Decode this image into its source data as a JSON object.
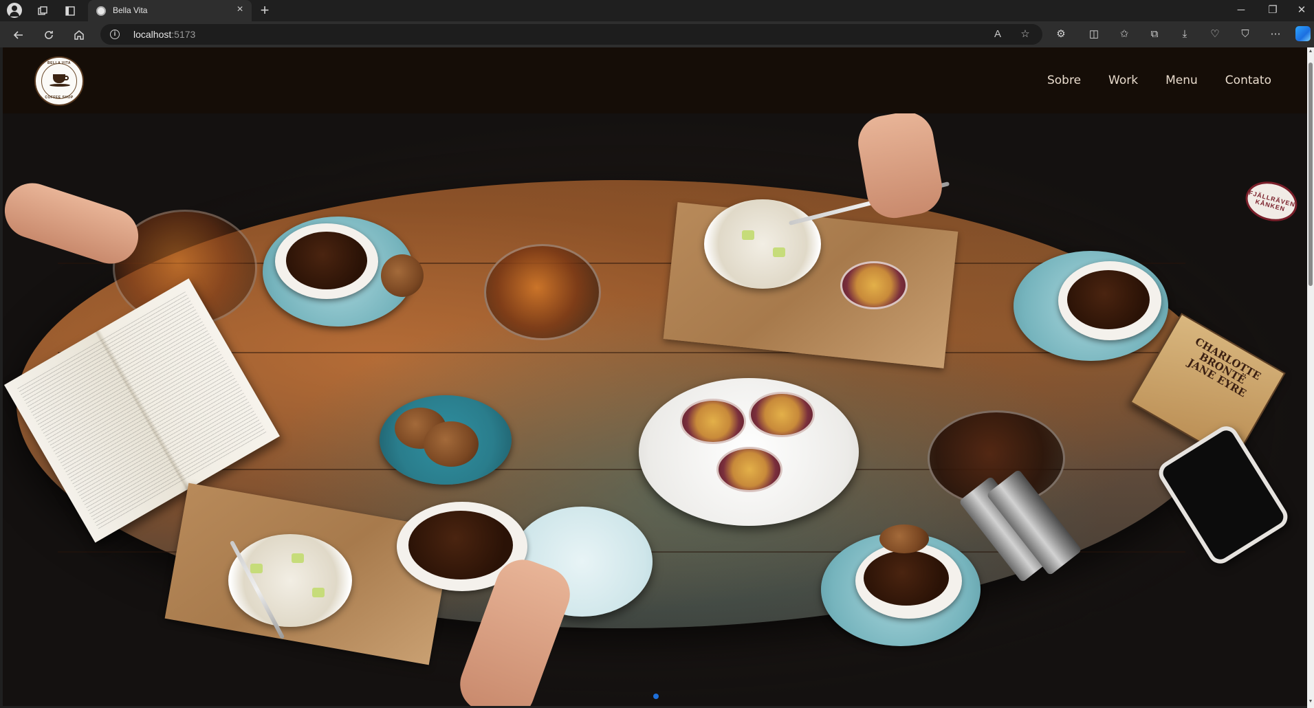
{
  "browser": {
    "tab_title": "Bella Vita",
    "tab_close": "×",
    "new_tab": "+",
    "url_host": "localhost",
    "url_port": ":5173",
    "window_controls": {
      "minimize": "─",
      "restore": "❐",
      "close": "✕"
    }
  },
  "site": {
    "logo": {
      "top_text": "BELLA VITA",
      "bottom_text": "COFFEE SHOP"
    },
    "nav": [
      {
        "label": "Sobre"
      },
      {
        "label": "Work"
      },
      {
        "label": "Menu"
      },
      {
        "label": "Contato"
      }
    ]
  },
  "hero": {
    "book_title": "CHARLOTTE BRONTË JANE EYRE",
    "sticker_text": "FJÄLLRÄVEN KÅNKEN",
    "carousel": {
      "active_index": 0,
      "accent_color": "#1e6fd9"
    }
  },
  "icons": {
    "back": "back-arrow-icon",
    "reload": "reload-icon",
    "home": "home-icon",
    "read_aloud": "read-aloud-icon",
    "favorite": "star-icon",
    "extensions": "puzzle-icon",
    "split": "split-screen-icon",
    "favorites": "favorites-icon",
    "collections": "collections-icon",
    "downloads": "download-icon",
    "performance": "heart-pulse-icon",
    "browser_essentials": "shield-icon",
    "more": "more-icon",
    "copilot": "copilot-icon"
  }
}
